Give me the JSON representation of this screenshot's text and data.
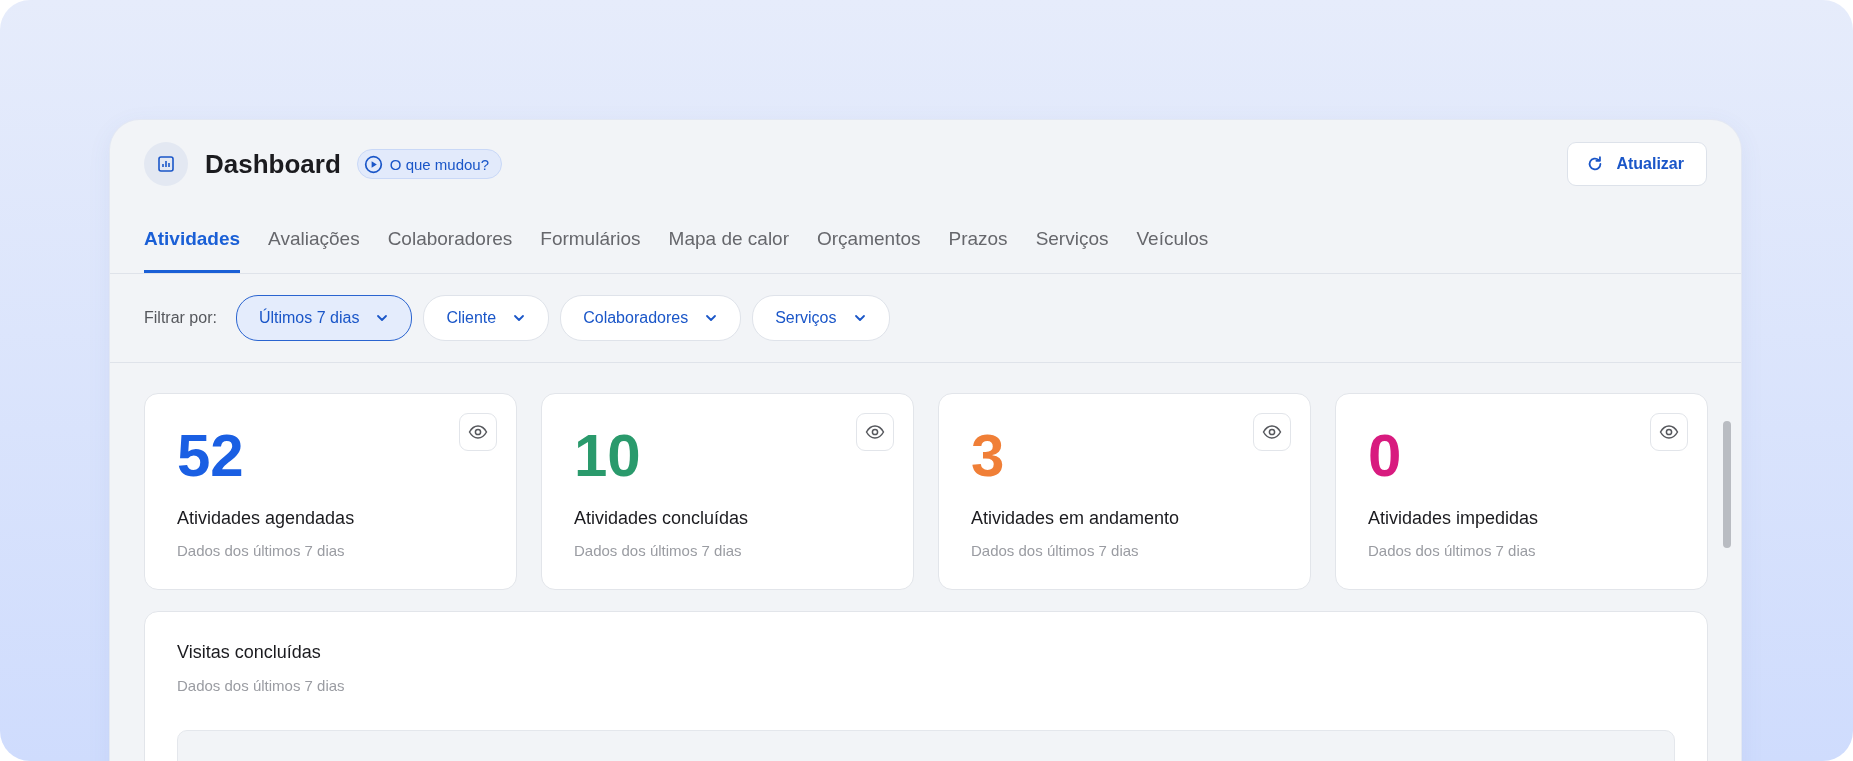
{
  "header": {
    "title": "Dashboard",
    "whats_new": "O que mudou?",
    "refresh_button": "Atualizar"
  },
  "tabs": [
    {
      "label": "Atividades",
      "selected": true
    },
    {
      "label": "Avaliações",
      "selected": false
    },
    {
      "label": "Colaboradores",
      "selected": false
    },
    {
      "label": "Formulários",
      "selected": false
    },
    {
      "label": "Mapa de calor",
      "selected": false
    },
    {
      "label": "Orçamentos",
      "selected": false
    },
    {
      "label": "Prazos",
      "selected": false
    },
    {
      "label": "Serviços",
      "selected": false
    },
    {
      "label": "Veículos",
      "selected": false
    }
  ],
  "filter_label": "Filtrar por:",
  "filters": [
    {
      "label": "Últimos 7 dias",
      "selected": true
    },
    {
      "label": "Cliente",
      "selected": false
    },
    {
      "label": "Colaboradores",
      "selected": false
    },
    {
      "label": "Serviços",
      "selected": false
    }
  ],
  "stats": [
    {
      "value": "52",
      "label": "Atividades agendadas",
      "subtitle": "Dados dos últimos 7 dias",
      "color": "#1a5fe3"
    },
    {
      "value": "10",
      "label": "Atividades concluídas",
      "subtitle": "Dados dos últimos 7 dias",
      "color": "#2a9a6c"
    },
    {
      "value": "3",
      "label": "Atividades em andamento",
      "subtitle": "Dados dos últimos 7 dias",
      "color": "#f07f37"
    },
    {
      "value": "0",
      "label": "Atividades impedidas",
      "subtitle": "Dados dos últimos 7 dias",
      "color": "#d81b7f"
    }
  ],
  "visits_card": {
    "title": "Visitas concluídas",
    "subtitle": "Dados dos últimos 7 dias"
  }
}
